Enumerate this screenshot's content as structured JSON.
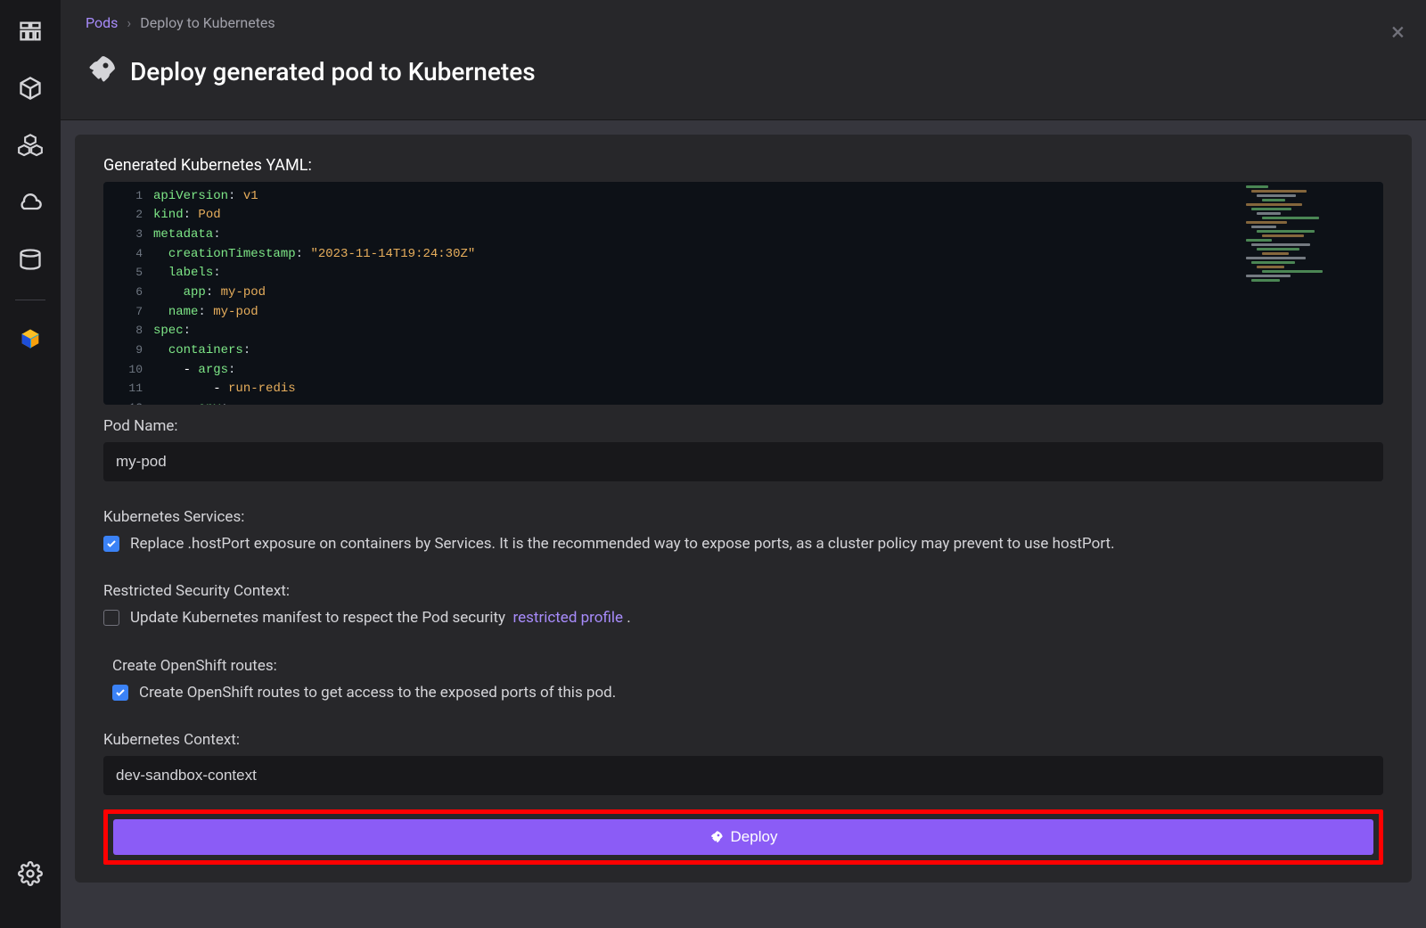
{
  "breadcrumb": {
    "root": "Pods",
    "current": "Deploy to Kubernetes"
  },
  "page_title": "Deploy generated pod to Kubernetes",
  "yaml_section_label": "Generated Kubernetes YAML:",
  "yaml_lines": [
    [
      [
        "key",
        "apiVersion"
      ],
      [
        "punc",
        ": "
      ],
      [
        "str",
        "v1"
      ]
    ],
    [
      [
        "key",
        "kind"
      ],
      [
        "punc",
        ": "
      ],
      [
        "str",
        "Pod"
      ]
    ],
    [
      [
        "key",
        "metadata"
      ],
      [
        "punc",
        ":"
      ]
    ],
    [
      [
        "punc",
        "  "
      ],
      [
        "key",
        "creationTimestamp"
      ],
      [
        "punc",
        ": "
      ],
      [
        "str",
        "\"2023-11-14T19:24:30Z\""
      ]
    ],
    [
      [
        "punc",
        "  "
      ],
      [
        "key",
        "labels"
      ],
      [
        "punc",
        ":"
      ]
    ],
    [
      [
        "punc",
        "    "
      ],
      [
        "key",
        "app"
      ],
      [
        "punc",
        ": "
      ],
      [
        "str",
        "my-pod"
      ]
    ],
    [
      [
        "punc",
        "  "
      ],
      [
        "key",
        "name"
      ],
      [
        "punc",
        ": "
      ],
      [
        "str",
        "my-pod"
      ]
    ],
    [
      [
        "key",
        "spec"
      ],
      [
        "punc",
        ":"
      ]
    ],
    [
      [
        "punc",
        "  "
      ],
      [
        "key",
        "containers"
      ],
      [
        "punc",
        ":"
      ]
    ],
    [
      [
        "punc",
        "    "
      ],
      [
        "list",
        "- "
      ],
      [
        "key",
        "args"
      ],
      [
        "punc",
        ":"
      ]
    ],
    [
      [
        "punc",
        "        "
      ],
      [
        "list",
        "- "
      ],
      [
        "str",
        "run-redis"
      ]
    ],
    [
      [
        "punc",
        "      "
      ],
      [
        "key",
        "env"
      ],
      [
        "punc",
        ":"
      ]
    ]
  ],
  "pod_name": {
    "label": "Pod Name:",
    "value": "my-pod"
  },
  "services": {
    "label": "Kubernetes Services:",
    "checked": true,
    "text": "Replace .hostPort exposure on containers by Services. It is the recommended way to expose ports, as a cluster policy may prevent to use hostPort."
  },
  "restricted": {
    "label": "Restricted Security Context:",
    "checked": false,
    "text_pre": "Update Kubernetes manifest to respect the Pod security",
    "link": "restricted profile",
    "text_post": "."
  },
  "routes": {
    "label": "Create OpenShift routes:",
    "checked": true,
    "text": "Create OpenShift routes to get access to the exposed ports of this pod."
  },
  "context": {
    "label": "Kubernetes Context:",
    "value": "dev-sandbox-context"
  },
  "deploy_label": "Deploy"
}
